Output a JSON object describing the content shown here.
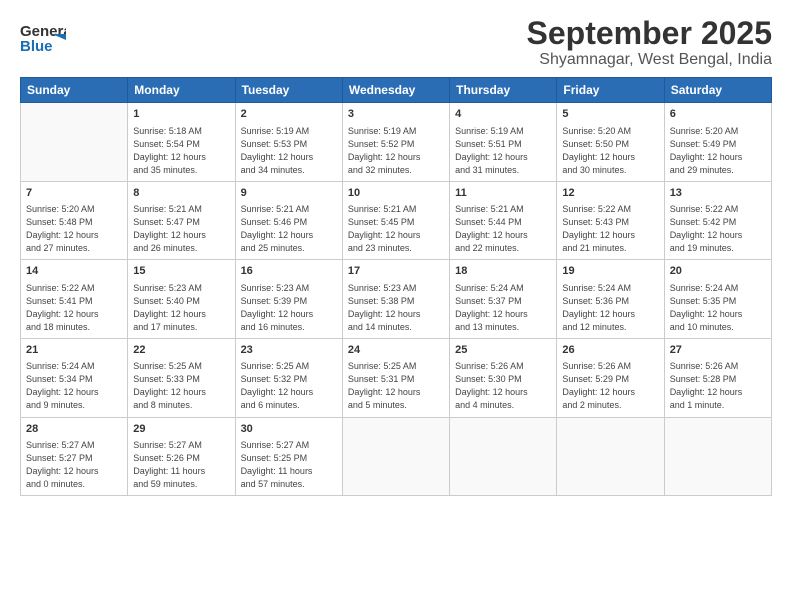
{
  "logo": {
    "line1": "General",
    "line2": "Blue"
  },
  "title": "September 2025",
  "subtitle": "Shyamnagar, West Bengal, India",
  "header": {
    "days": [
      "Sunday",
      "Monday",
      "Tuesday",
      "Wednesday",
      "Thursday",
      "Friday",
      "Saturday"
    ]
  },
  "weeks": [
    [
      {
        "num": "",
        "info": ""
      },
      {
        "num": "1",
        "info": "Sunrise: 5:18 AM\nSunset: 5:54 PM\nDaylight: 12 hours\nand 35 minutes."
      },
      {
        "num": "2",
        "info": "Sunrise: 5:19 AM\nSunset: 5:53 PM\nDaylight: 12 hours\nand 34 minutes."
      },
      {
        "num": "3",
        "info": "Sunrise: 5:19 AM\nSunset: 5:52 PM\nDaylight: 12 hours\nand 32 minutes."
      },
      {
        "num": "4",
        "info": "Sunrise: 5:19 AM\nSunset: 5:51 PM\nDaylight: 12 hours\nand 31 minutes."
      },
      {
        "num": "5",
        "info": "Sunrise: 5:20 AM\nSunset: 5:50 PM\nDaylight: 12 hours\nand 30 minutes."
      },
      {
        "num": "6",
        "info": "Sunrise: 5:20 AM\nSunset: 5:49 PM\nDaylight: 12 hours\nand 29 minutes."
      }
    ],
    [
      {
        "num": "7",
        "info": "Sunrise: 5:20 AM\nSunset: 5:48 PM\nDaylight: 12 hours\nand 27 minutes."
      },
      {
        "num": "8",
        "info": "Sunrise: 5:21 AM\nSunset: 5:47 PM\nDaylight: 12 hours\nand 26 minutes."
      },
      {
        "num": "9",
        "info": "Sunrise: 5:21 AM\nSunset: 5:46 PM\nDaylight: 12 hours\nand 25 minutes."
      },
      {
        "num": "10",
        "info": "Sunrise: 5:21 AM\nSunset: 5:45 PM\nDaylight: 12 hours\nand 23 minutes."
      },
      {
        "num": "11",
        "info": "Sunrise: 5:21 AM\nSunset: 5:44 PM\nDaylight: 12 hours\nand 22 minutes."
      },
      {
        "num": "12",
        "info": "Sunrise: 5:22 AM\nSunset: 5:43 PM\nDaylight: 12 hours\nand 21 minutes."
      },
      {
        "num": "13",
        "info": "Sunrise: 5:22 AM\nSunset: 5:42 PM\nDaylight: 12 hours\nand 19 minutes."
      }
    ],
    [
      {
        "num": "14",
        "info": "Sunrise: 5:22 AM\nSunset: 5:41 PM\nDaylight: 12 hours\nand 18 minutes."
      },
      {
        "num": "15",
        "info": "Sunrise: 5:23 AM\nSunset: 5:40 PM\nDaylight: 12 hours\nand 17 minutes."
      },
      {
        "num": "16",
        "info": "Sunrise: 5:23 AM\nSunset: 5:39 PM\nDaylight: 12 hours\nand 16 minutes."
      },
      {
        "num": "17",
        "info": "Sunrise: 5:23 AM\nSunset: 5:38 PM\nDaylight: 12 hours\nand 14 minutes."
      },
      {
        "num": "18",
        "info": "Sunrise: 5:24 AM\nSunset: 5:37 PM\nDaylight: 12 hours\nand 13 minutes."
      },
      {
        "num": "19",
        "info": "Sunrise: 5:24 AM\nSunset: 5:36 PM\nDaylight: 12 hours\nand 12 minutes."
      },
      {
        "num": "20",
        "info": "Sunrise: 5:24 AM\nSunset: 5:35 PM\nDaylight: 12 hours\nand 10 minutes."
      }
    ],
    [
      {
        "num": "21",
        "info": "Sunrise: 5:24 AM\nSunset: 5:34 PM\nDaylight: 12 hours\nand 9 minutes."
      },
      {
        "num": "22",
        "info": "Sunrise: 5:25 AM\nSunset: 5:33 PM\nDaylight: 12 hours\nand 8 minutes."
      },
      {
        "num": "23",
        "info": "Sunrise: 5:25 AM\nSunset: 5:32 PM\nDaylight: 12 hours\nand 6 minutes."
      },
      {
        "num": "24",
        "info": "Sunrise: 5:25 AM\nSunset: 5:31 PM\nDaylight: 12 hours\nand 5 minutes."
      },
      {
        "num": "25",
        "info": "Sunrise: 5:26 AM\nSunset: 5:30 PM\nDaylight: 12 hours\nand 4 minutes."
      },
      {
        "num": "26",
        "info": "Sunrise: 5:26 AM\nSunset: 5:29 PM\nDaylight: 12 hours\nand 2 minutes."
      },
      {
        "num": "27",
        "info": "Sunrise: 5:26 AM\nSunset: 5:28 PM\nDaylight: 12 hours\nand 1 minute."
      }
    ],
    [
      {
        "num": "28",
        "info": "Sunrise: 5:27 AM\nSunset: 5:27 PM\nDaylight: 12 hours\nand 0 minutes."
      },
      {
        "num": "29",
        "info": "Sunrise: 5:27 AM\nSunset: 5:26 PM\nDaylight: 11 hours\nand 59 minutes."
      },
      {
        "num": "30",
        "info": "Sunrise: 5:27 AM\nSunset: 5:25 PM\nDaylight: 11 hours\nand 57 minutes."
      },
      {
        "num": "",
        "info": ""
      },
      {
        "num": "",
        "info": ""
      },
      {
        "num": "",
        "info": ""
      },
      {
        "num": "",
        "info": ""
      }
    ]
  ]
}
